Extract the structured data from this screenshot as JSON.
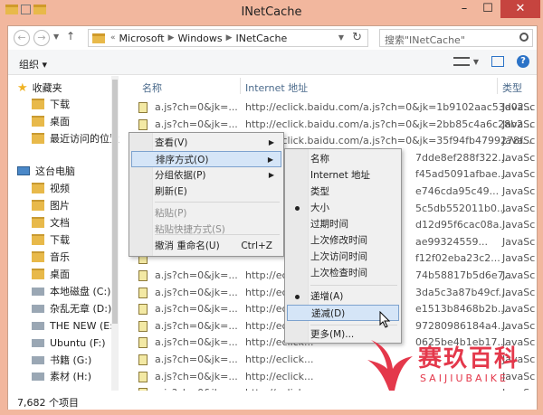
{
  "window": {
    "title": "INetCache"
  },
  "address": {
    "crumbs": [
      "Microsoft",
      "Windows",
      "INetCache"
    ],
    "prefix": "«"
  },
  "search": {
    "placeholder": "搜索\"INetCache\""
  },
  "toolbar": {
    "organize_label": "组织 ▾"
  },
  "sidebar": {
    "items": [
      {
        "label": "收藏夹",
        "icon": "star-icon"
      },
      {
        "label": "下载",
        "icon": "download-folder-icon"
      },
      {
        "label": "桌面",
        "icon": "desktop-icon"
      },
      {
        "label": "最近访问的位置",
        "icon": "recent-places-icon"
      },
      {
        "label": "这台电脑",
        "icon": "computer-icon"
      },
      {
        "label": "视频",
        "icon": "video-folder-icon"
      },
      {
        "label": "图片",
        "icon": "pictures-folder-icon"
      },
      {
        "label": "文档",
        "icon": "documents-folder-icon"
      },
      {
        "label": "下载",
        "icon": "download-folder-icon"
      },
      {
        "label": "音乐",
        "icon": "music-folder-icon"
      },
      {
        "label": "桌面",
        "icon": "desktop-icon"
      },
      {
        "label": "本地磁盘 (C:)",
        "icon": "drive-icon"
      },
      {
        "label": "杂乱无章 (D:)",
        "icon": "drive-icon"
      },
      {
        "label": "THE NEW (E:)",
        "icon": "drive-icon"
      },
      {
        "label": "Ubuntu (F:)",
        "icon": "drive-icon"
      },
      {
        "label": "书籍 (G:)",
        "icon": "drive-icon"
      },
      {
        "label": "素材 (H:)",
        "icon": "drive-icon"
      }
    ]
  },
  "list": {
    "columns": [
      "名称",
      "Internet 地址",
      "类型"
    ],
    "rows": [
      {
        "name": "a.js?ch=0&jk=...",
        "url": "http://eclick.baidu.com/a.js?ch=0&jk=1b9102aac53d02...",
        "type": "JavaSc"
      },
      {
        "name": "a.js?ch=0&jk=...",
        "url": "http://eclick.baidu.com/a.js?ch=0&jk=2bb85c4a6c28b2...",
        "type": "JavaSc"
      },
      {
        "name": "a.js?ch=0&jk=...",
        "url": "http://eclick.baidu.com/a.js?ch=0&jk=35f94fb4799278f...",
        "type": "JavaSc"
      },
      {
        "name": "",
        "url": "7dde8ef288f322...",
        "type": "JavaSc"
      },
      {
        "name": "",
        "url": "f45ad5091afbae...",
        "type": "JavaSc"
      },
      {
        "name": "",
        "url": "e746cda95c49...",
        "type": "JavaSc"
      },
      {
        "name": "",
        "url": "5c5db552011b0...",
        "type": "JavaSc"
      },
      {
        "name": "",
        "url": "d12d95f6cac08a...",
        "type": "JavaSc"
      },
      {
        "name": "",
        "url": "ae99324559...",
        "type": "JavaSc"
      },
      {
        "name": "",
        "url": "f12f02eba23c2...",
        "type": "JavaSc"
      },
      {
        "name": "a.js?ch=0&jk=...",
        "url": "http://eclick...",
        "type": "JavaSc"
      },
      {
        "name": "a.js?ch=0&jk=...",
        "url": "http://eclick...",
        "type": "JavaSc"
      },
      {
        "name": "a.js?ch=0&jk=...",
        "url": "http://eclick...",
        "type": "JavaSc"
      },
      {
        "name": "a.js?ch=0&jk=...",
        "url": "http://eclick...",
        "type": "JavaSc"
      },
      {
        "name": "a.js?ch=0&jk=...",
        "url": "http://eclick...",
        "type": "JavaSc"
      },
      {
        "name": "a.js?ch=0&jk=...",
        "url": "http://eclick...",
        "type": "JavaSc"
      },
      {
        "name": "a.js?ch=0&jk=...",
        "url": "http://eclick...",
        "type": "JavaSc"
      },
      {
        "name": "a.js?ch=0&jk=...",
        "url": "http://eclick...",
        "type": "JavaSc"
      }
    ],
    "tails": [
      "74b58817b5d6e7...",
      "3da5c3a87b49cf...",
      "e1513b8468b2b...",
      "97280986184a4...",
      "0625be4b1eb17..."
    ]
  },
  "status": {
    "items_label": "7,682 个项目"
  },
  "context_menu": {
    "items": [
      {
        "label": "查看(V)",
        "arrow": "▶"
      },
      {
        "label": "排序方式(O)",
        "arrow": "▶"
      },
      {
        "label": "分组依据(P)",
        "arrow": "▶"
      },
      {
        "label": "刷新(E)"
      },
      {
        "label": "粘贴(P)"
      },
      {
        "label": "粘贴快捷方式(S)"
      },
      {
        "label": "撤消 重命名(U)",
        "shortcut": "Ctrl+Z"
      }
    ]
  },
  "sort_submenu": {
    "items": [
      "名称",
      "Internet 地址",
      "类型",
      "大小",
      "过期时间",
      "上次修改时间",
      "上次访问时间",
      "上次检查时间"
    ],
    "order_items": [
      "递增(A)",
      "递减(D)"
    ],
    "more_label": "更多(M)..."
  },
  "watermark": {
    "title": "赛玖百科",
    "subtitle": "SAIJIUBAIKE"
  },
  "colors": {
    "titlebar": "#f2b79e",
    "close": "#c6443f",
    "accent": "#e4384b",
    "highlight": "#d5e5f7"
  }
}
